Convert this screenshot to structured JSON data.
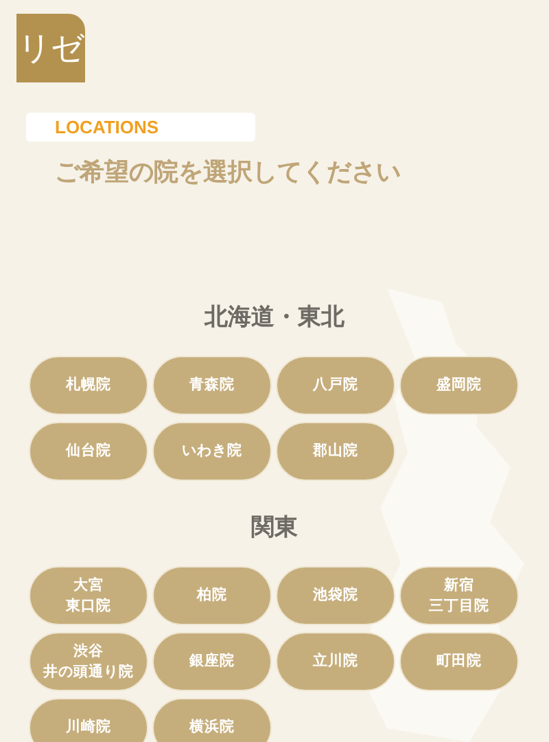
{
  "logo": {
    "text": "リゼ"
  },
  "header": {
    "label": "LOCATIONS",
    "title": "ご希望の院を選択してください"
  },
  "regions": [
    {
      "name": "北海道・東北",
      "clinics": [
        [
          "札幌院"
        ],
        [
          "青森院"
        ],
        [
          "八戸院"
        ],
        [
          "盛岡院"
        ],
        [
          "仙台院"
        ],
        [
          "いわき院"
        ],
        [
          "郡山院"
        ]
      ]
    },
    {
      "name": "関東",
      "clinics": [
        [
          "大宮",
          "東口院"
        ],
        [
          "柏院"
        ],
        [
          "池袋院"
        ],
        [
          "新宿",
          "三丁目院"
        ],
        [
          "渋谷",
          "井の頭通り院"
        ],
        [
          "銀座院"
        ],
        [
          "立川院"
        ],
        [
          "町田院"
        ],
        [
          "川崎院"
        ],
        [
          "横浜院"
        ]
      ]
    }
  ]
}
